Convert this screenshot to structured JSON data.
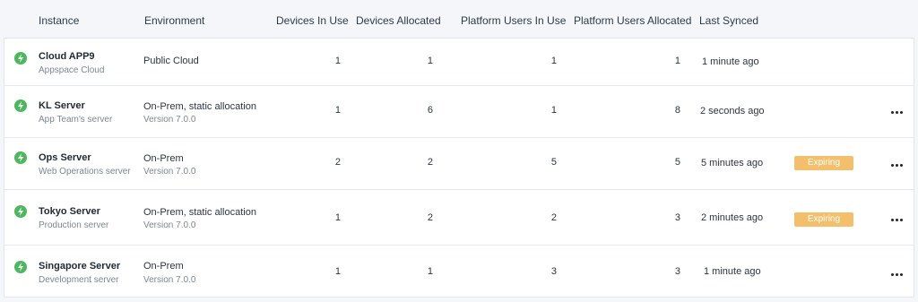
{
  "columns": {
    "instance": "Instance",
    "environment": "Environment",
    "devices_in_use": "Devices In Use",
    "devices_allocated": "Devices Allocated",
    "platform_users_in_use": "Platform Users In Use",
    "platform_users_allocated": "Platform Users Allocated",
    "last_synced": "Last Synced"
  },
  "rows": [
    {
      "name": "Cloud APP9",
      "description": "Appspace Cloud",
      "environment": "Public Cloud",
      "version": "",
      "devices_in_use": "1",
      "devices_allocated": "1",
      "users_in_use": "1",
      "users_allocated": "1",
      "last_synced": "1 minute ago",
      "badge": "",
      "status_icon": "bolt-icon",
      "has_menu": false
    },
    {
      "name": "KL Server",
      "description": "App Team's  server",
      "environment": "On-Prem, static allocation",
      "version": "Version 7.0.0",
      "devices_in_use": "1",
      "devices_allocated": "6",
      "users_in_use": "1",
      "users_allocated": "8",
      "last_synced": "2 seconds ago",
      "badge": "",
      "status_icon": "bolt-icon",
      "has_menu": true
    },
    {
      "name": "Ops Server",
      "description": "Web Operations server",
      "environment": "On-Prem",
      "version": "Version 7.0.0",
      "devices_in_use": "2",
      "devices_allocated": "2",
      "users_in_use": "5",
      "users_allocated": "5",
      "last_synced": "5 minutes ago",
      "badge": "Expiring",
      "status_icon": "bolt-icon",
      "has_menu": true
    },
    {
      "name": "Tokyo Server",
      "description": "Production server",
      "environment": "On-Prem, static allocation",
      "version": "Version 7.0.0",
      "devices_in_use": "1",
      "devices_allocated": "2",
      "users_in_use": "2",
      "users_allocated": "3",
      "last_synced": "2 minutes ago",
      "badge": "Expiring",
      "status_icon": "bolt-icon",
      "has_menu": true
    },
    {
      "name": "Singapore Server",
      "description": "Development  server",
      "environment": "On-Prem",
      "version": "Version 7.0.0",
      "devices_in_use": "1",
      "devices_allocated": "1",
      "users_in_use": "3",
      "users_allocated": "3",
      "last_synced": "1 minute ago",
      "badge": "",
      "status_icon": "bolt-icon",
      "has_menu": true
    }
  ],
  "colors": {
    "status_ok": "#4cb85c",
    "badge_expiring": "#f3bf6b"
  }
}
